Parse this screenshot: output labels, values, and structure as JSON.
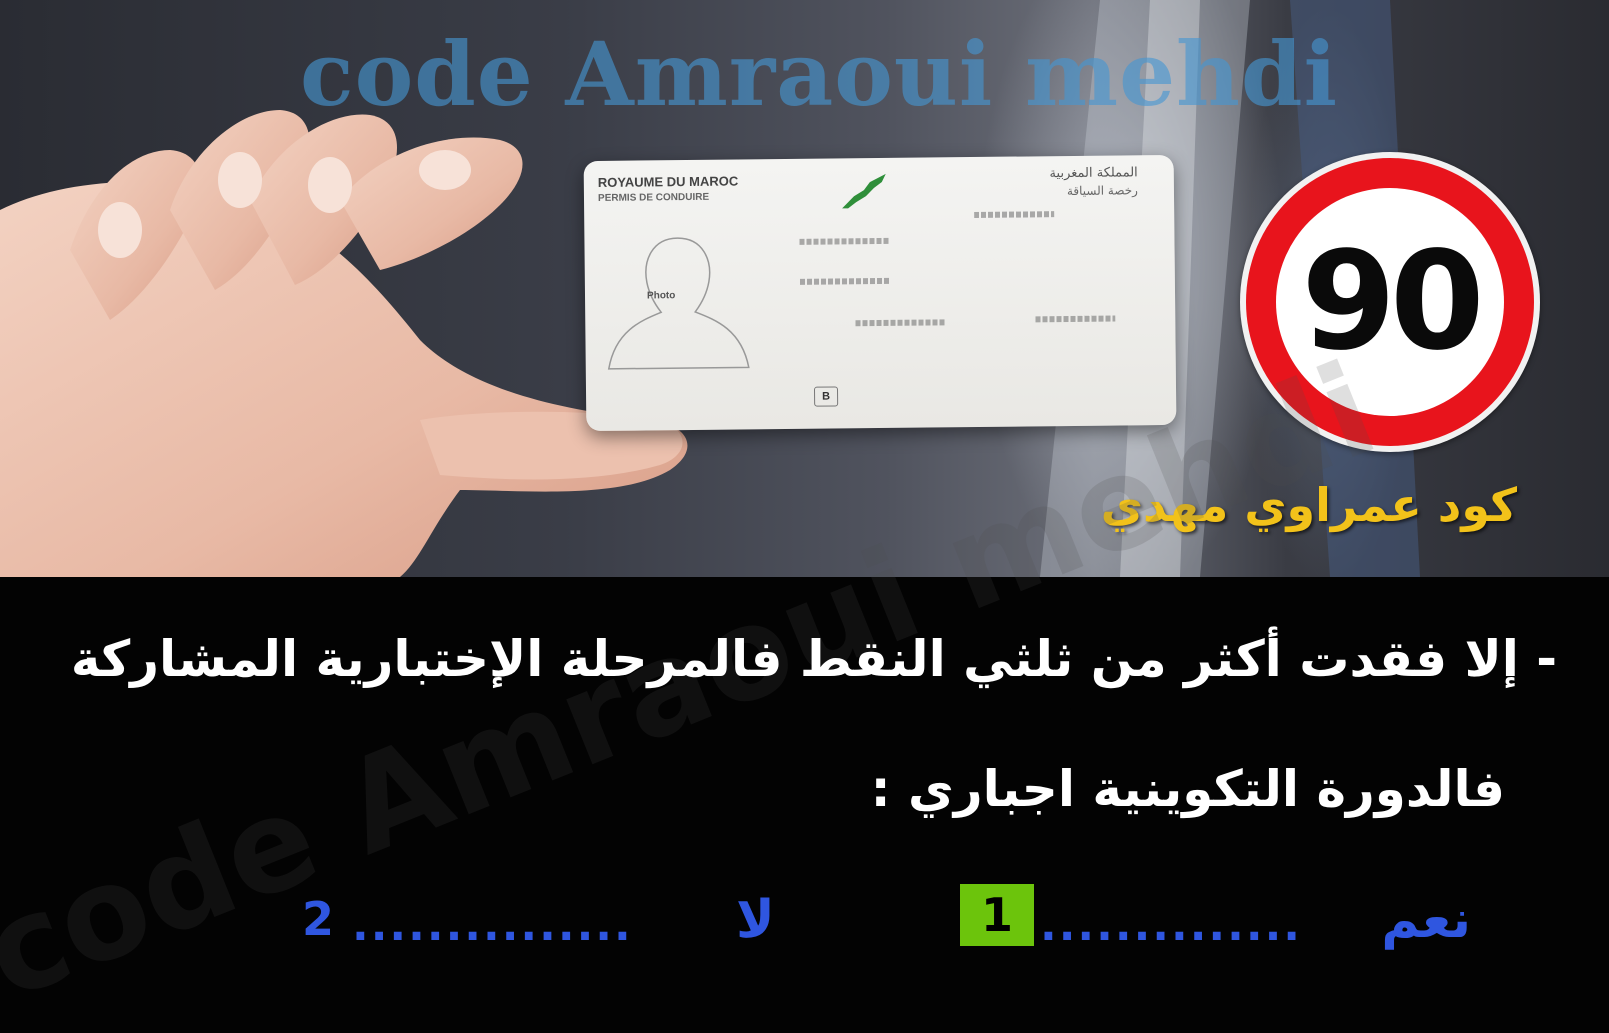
{
  "watermark": {
    "top_text": "code Amraoui mehdi",
    "diagonal_text": "code Amraoui mehdi"
  },
  "license_card": {
    "header_fr": "ROYAUME DU MAROC",
    "subheader_fr": "PERMIS DE CONDUIRE",
    "header_ar": "المملكة المغربية",
    "subheader_ar": "رخصة السياقة",
    "photo_label": "Photo",
    "category": "B"
  },
  "speed_sign": {
    "value": "90",
    "ring_color": "#e8141c"
  },
  "brand": {
    "arabic_name": "كود عمراوي مهدي",
    "color": "#f2c21a"
  },
  "question": {
    "line1": "- إلا فقدت أكثر من ثلثي النقط فالمرحلة الإختبارية المشاركة",
    "line2": "فالدورة التكوينية اجباري :"
  },
  "options": [
    {
      "label": "نعم",
      "dots": "..............",
      "number": "1",
      "selected": true,
      "highlight_color": "#6cc40c"
    },
    {
      "label": "لا",
      "dots": "...............",
      "number": "2",
      "selected": false
    }
  ],
  "colors": {
    "answer_text": "#2f56e0",
    "question_text": "#ffffff"
  }
}
